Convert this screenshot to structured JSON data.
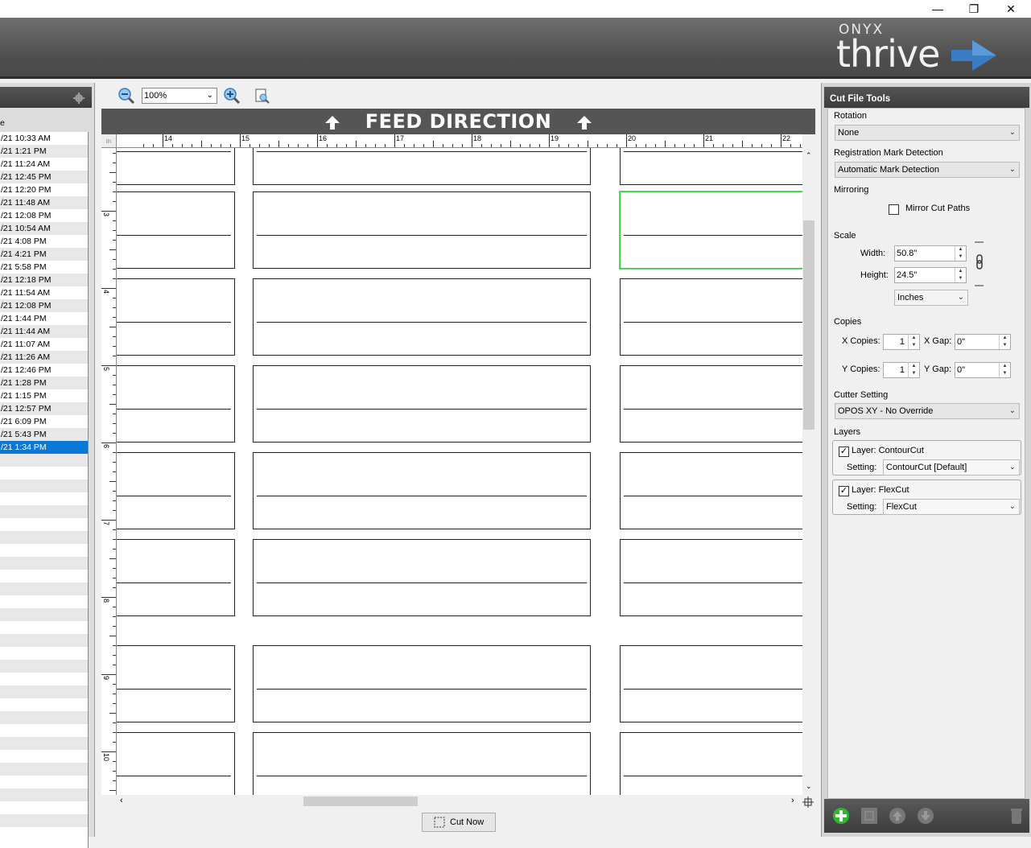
{
  "window": {
    "minimize": "—",
    "restore": "❐",
    "close": "✕"
  },
  "brand": {
    "top": "ONYX",
    "name": "thrive",
    "accent": "#3a7cc4"
  },
  "job_list": {
    "header_partial": "e",
    "rows": [
      "/21 10:33 AM",
      "/21 1:21 PM",
      "/21 11:24 AM",
      "/21 12:45 PM",
      "/21 12:20 PM",
      "/21 11:48 AM",
      "/21 12:08 PM",
      "/21 10:54 AM",
      "/21 4:08 PM",
      "/21 4:21 PM",
      "/21 5:58 PM",
      "/21 12:18 PM",
      "/21 11:54 AM",
      "/21 12:08 PM",
      "/21 1:44 PM",
      "/21 11:44 AM",
      "/21 11:07 AM",
      "/21 11:26 AM",
      "/21 12:46 PM",
      "/21 1:28 PM",
      "/21 1:15 PM",
      "/21 12:57 PM",
      "/21 6:09 PM",
      "/21 5:43 PM",
      "/21 1:34 PM"
    ],
    "selected_index": 24
  },
  "toolbar": {
    "zoom_value": "100%"
  },
  "feed": {
    "label": "FEED DIRECTION"
  },
  "ruler": {
    "unit": "in",
    "h_ticks": [
      "14",
      "15",
      "16",
      "17",
      "18",
      "19",
      "20",
      "21",
      "22"
    ],
    "v_ticks": [
      "3",
      "4",
      "5",
      "6",
      "7",
      "8",
      "9",
      "10"
    ]
  },
  "cut_now": {
    "label": "Cut Now"
  },
  "cut_tools": {
    "title": "Cut File Tools",
    "rotation": {
      "label": "Rotation",
      "value": "None"
    },
    "registration": {
      "label": "Registration Mark Detection",
      "value": "Automatic Mark Detection"
    },
    "mirroring": {
      "label": "Mirroring",
      "checkbox_label": "Mirror Cut Paths",
      "checked": false
    },
    "scale": {
      "label": "Scale",
      "width_label": "Width:",
      "width": "50.8\"",
      "height_label": "Height:",
      "height": "24.5\"",
      "units": "Inches"
    },
    "copies": {
      "label": "Copies",
      "x_label": "X Copies:",
      "x_value": "1",
      "xgap_label": "X Gap:",
      "xgap_value": "0\"",
      "y_label": "Y Copies:",
      "y_value": "1",
      "ygap_label": "Y Gap:",
      "ygap_value": "0\""
    },
    "cutter": {
      "label": "Cutter Setting",
      "value": "OPOS XY - No Override"
    },
    "layers": {
      "label": "Layers",
      "items": [
        {
          "name": "Layer: ContourCut",
          "setting_label": "Setting:",
          "setting": "ContourCut [Default]",
          "checked": true
        },
        {
          "name": "Layer: FlexCut",
          "setting_label": "Setting:",
          "setting": "FlexCut",
          "checked": true
        }
      ]
    }
  }
}
